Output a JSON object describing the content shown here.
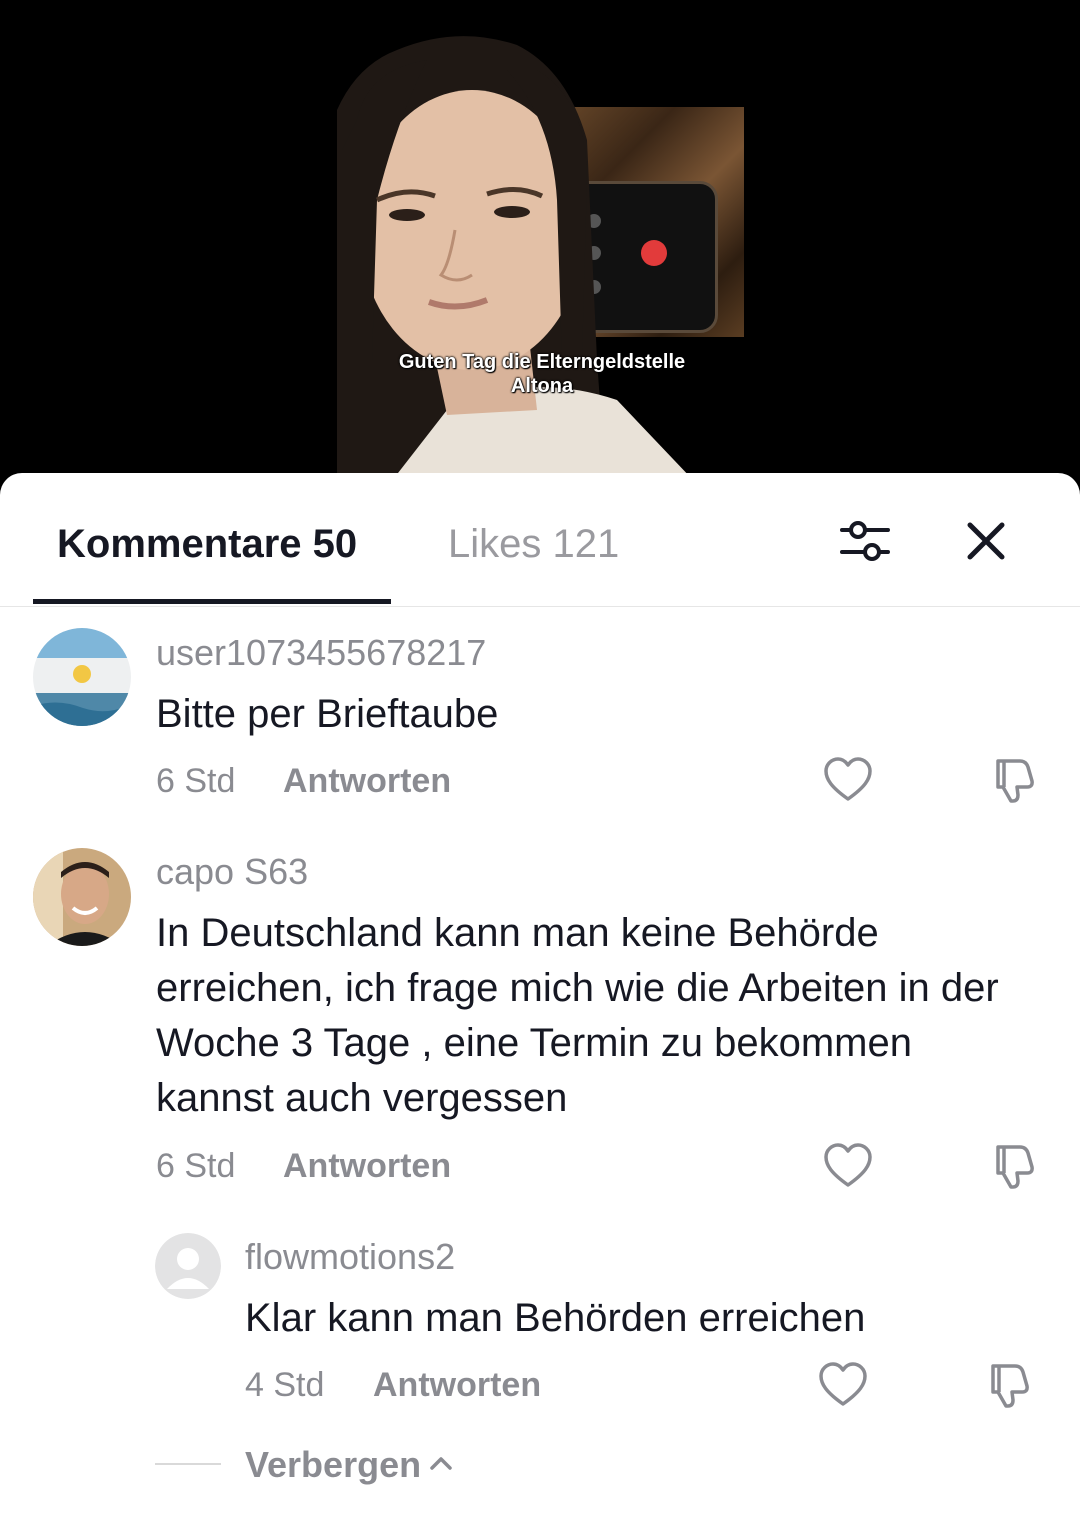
{
  "video": {
    "caption_line1": "Guten Tag die Elterngeldstelle",
    "caption_line2": "Altona"
  },
  "tabs": {
    "comments_label": "Kommentare 50",
    "likes_label": "Likes 121",
    "active": "comments"
  },
  "icons": {
    "filter": "sliders-icon",
    "close": "close-icon",
    "like": "heart-outline-icon",
    "dislike": "thumbs-down-icon",
    "chevron": "chevron-up-icon"
  },
  "comments": [
    {
      "username": "user1073455678217",
      "text": "Bitte per Brieftaube",
      "time": "6 Std",
      "reply_label": "Antworten"
    },
    {
      "username": "capo S63",
      "text": "In Deutschland kann man keine Behörde erreichen, ich frage mich wie die Arbeiten in der Woche 3 Tage , eine Termin zu bekommen kannst auch vergessen",
      "time": "6 Std",
      "reply_label": "Antworten"
    }
  ],
  "replies": [
    {
      "username": "flowmotions2",
      "text": "Klar kann man Behörden erreichen",
      "time": "4 Std",
      "reply_label": "Antworten"
    }
  ],
  "hide_label": "Verbergen",
  "colors": {
    "primary_text": "#161823",
    "secondary_text": "#8a8b91",
    "end_call": "#e23b3b"
  }
}
